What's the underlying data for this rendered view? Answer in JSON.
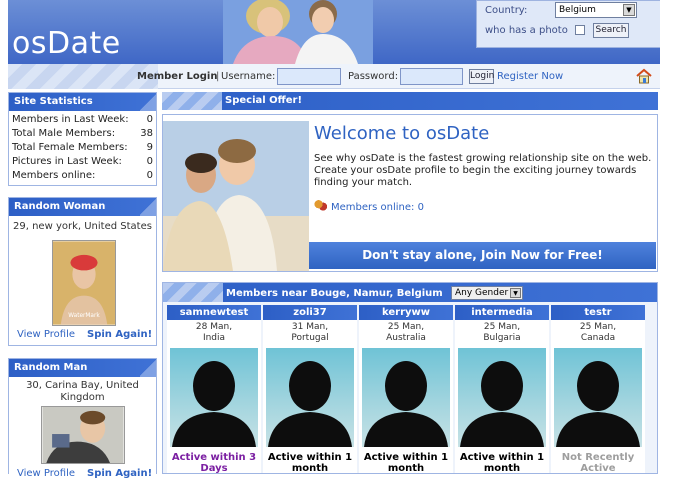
{
  "header": {
    "logo": "osDate"
  },
  "search": {
    "country_label": "Country:",
    "country_value": "Belgium",
    "photo_label": "who has a photo",
    "button": "Search"
  },
  "login": {
    "title": "Member Login",
    "username_label": "Username:",
    "password_label": "Password:",
    "button": "Login",
    "register": "Register Now"
  },
  "stats": {
    "title": "Site Statistics",
    "rows": [
      {
        "label": "Members in Last Week:",
        "value": "0"
      },
      {
        "label": "Total Male Members:",
        "value": "38"
      },
      {
        "label": "Total Female Members:",
        "value": "9"
      },
      {
        "label": "Pictures in Last Week:",
        "value": "0"
      },
      {
        "label": "Members online:",
        "value": "0"
      }
    ]
  },
  "random_woman": {
    "title": "Random Woman",
    "info": "29, new york, United States",
    "watermark": "WaterMark",
    "view": "View Profile",
    "spin": "Spin Again!"
  },
  "random_man": {
    "title": "Random Man",
    "info": "30, Carina Bay, United Kingdom",
    "view": "View Profile",
    "spin": "Spin Again!"
  },
  "special": {
    "title": "Special Offer!"
  },
  "welcome": {
    "title": "Welcome to osDate",
    "text": "See why osDate is the fastest growing relationship site on the web. Create your osDate profile to begin the exciting journey towards finding your match.",
    "online": "Members online:  0",
    "join": "Don't stay alone, Join Now for Free!"
  },
  "members": {
    "title": "Members near Bouge, Namur, Belgium",
    "gender": "Any Gender",
    "list": [
      {
        "name": "samnewtest",
        "info1": "28 Man,",
        "info2": "India",
        "status": "Active within 3 Days",
        "color": "#7b1fa2"
      },
      {
        "name": "zoli37",
        "info1": "31 Man,",
        "info2": "Portugal",
        "status": "Active within 1 month",
        "color": "#000000"
      },
      {
        "name": "kerryww",
        "info1": "25 Man,",
        "info2": "Australia",
        "status": "Active within 1 month",
        "color": "#000000"
      },
      {
        "name": "intermedia",
        "info1": "25 Man,",
        "info2": "Bulgaria",
        "status": "Active within 1 month",
        "color": "#000000"
      },
      {
        "name": "testr",
        "info1": "25 Man,",
        "info2": "Canada",
        "status": "Not Recently Active",
        "color": "#9e9e9e"
      }
    ]
  },
  "colors": {
    "brand": "#2f63c2",
    "header": "#3f67c6"
  }
}
